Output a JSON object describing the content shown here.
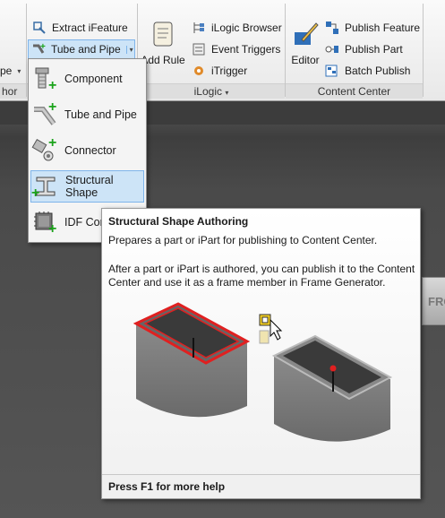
{
  "ribbon": {
    "left_panel": {
      "partial_label": "pe",
      "partial_title": "hor"
    },
    "author_panel": {
      "extract_ifeature": "Extract iFeature",
      "tube_and_pipe": "Tube and Pipe"
    },
    "ilogic_panel": {
      "title": "iLogic",
      "add_rule": "Add Rule",
      "browser": "iLogic Browser",
      "event_triggers": "Event Triggers",
      "itrigger": "iTrigger"
    },
    "content_center_panel": {
      "title": "Content Center",
      "editor": "Editor",
      "publish_feature": "Publish Feature",
      "publish_part": "Publish Part",
      "batch_publish": "Batch Publish"
    }
  },
  "menu": {
    "items": [
      {
        "label": "Component",
        "icon": "bolt-component-icon"
      },
      {
        "label": "Tube and Pipe",
        "icon": "tube-pipe-icon"
      },
      {
        "label": "Connector",
        "icon": "connector-icon"
      },
      {
        "label": "Structural Shape",
        "icon": "structural-shape-icon",
        "highlighted": true
      },
      {
        "label": "IDF Con",
        "icon": "idf-chip-icon"
      }
    ]
  },
  "canvas": {
    "side_tab": "FRO"
  },
  "tooltip": {
    "title": "Structural Shape Authoring",
    "description": "Prepares a part or iPart for publishing to Content Center.",
    "body": "After a part or iPart is authored, you can publish it to the Content Center and use it as a frame member in Frame Generator.",
    "footer": "Press F1 for more help"
  },
  "colors": {
    "highlight_bg": "#cde4f7",
    "highlight_border": "#7eb4ea",
    "plus_green": "#1aa31a",
    "edge_red": "#e02020"
  }
}
